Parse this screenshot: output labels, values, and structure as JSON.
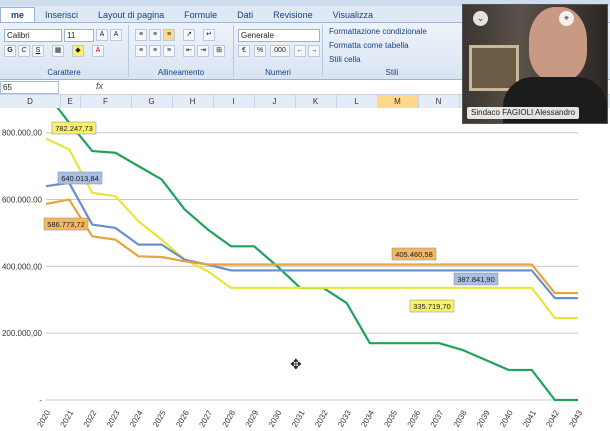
{
  "ribbon": {
    "tabs": [
      "me",
      "Inserisci",
      "Layout di pagina",
      "Formule",
      "Dati",
      "Revisione",
      "Visualizza"
    ],
    "active_tab": "me",
    "font_name": "Calibri",
    "font_size": "11",
    "number_format": "Generale",
    "percent_symbol": "%",
    "thousands": "000",
    "cond_format": "Formattazione condizionale",
    "format_table": "Formatta come tabella",
    "cell_styles": "Stili cella",
    "groups": {
      "font": "Carattere",
      "align": "Allineamento",
      "number": "Numeri",
      "styles": "Stili"
    }
  },
  "formula_bar": {
    "name_box": "65",
    "fx": "fx",
    "content": ""
  },
  "columns": [
    "D",
    "E",
    "F",
    "G",
    "H",
    "I",
    "J",
    "K",
    "L",
    "M",
    "N"
  ],
  "selected_column": "M",
  "video": {
    "participant": "Sindaco FAGIOLI Alessandro"
  },
  "chart_data": {
    "type": "line",
    "x": [
      "2020",
      "2021",
      "2022",
      "2023",
      "2024",
      "2025",
      "2026",
      "2027",
      "2028",
      "2029",
      "2030",
      "2031",
      "2032",
      "2033",
      "2034",
      "2035",
      "2036",
      "2037",
      "2038",
      "2039",
      "2040",
      "2041",
      "2042",
      "2043"
    ],
    "y_tick_labels": [
      "800.000,00",
      "600.000,00",
      "400.000,00",
      "200.000,00",
      "-"
    ],
    "ylim": [
      0,
      850000
    ],
    "grid": true,
    "series": [
      {
        "color": "#1fa35a",
        "values": [
          920000,
          830000,
          745000,
          740000,
          700000,
          660000,
          570000,
          510000,
          460000,
          460000,
          400000,
          335000,
          335000,
          290000,
          170000,
          170000,
          170000,
          170000,
          150000,
          120000,
          90000,
          90000,
          0,
          0
        ]
      },
      {
        "color": "#e8e43b",
        "values": [
          782247.73,
          750000,
          620000,
          610000,
          535000,
          480000,
          420000,
          385000,
          335719.7,
          335719.7,
          335719.7,
          335719.7,
          335719.7,
          335719.7,
          335719.7,
          335719.7,
          335719.7,
          335719.7,
          335719.7,
          335719.7,
          335719.7,
          335719.7,
          245000,
          245000
        ]
      },
      {
        "color": "#6a8fc8",
        "values": [
          640013.84,
          650000,
          525000,
          515000,
          465000,
          465000,
          420000,
          405000,
          387841.9,
          387841.9,
          387841.9,
          387841.9,
          387841.9,
          387841.9,
          387841.9,
          387841.9,
          387841.9,
          387841.9,
          387841.9,
          387841.9,
          387841.9,
          387841.9,
          305000,
          305000
        ]
      },
      {
        "color": "#e6a43a",
        "values": [
          586773.72,
          600000,
          490000,
          480000,
          430000,
          428000,
          415000,
          405460.58,
          405460.58,
          405460.58,
          405460.58,
          405460.58,
          405460.58,
          405460.58,
          405460.58,
          405460.58,
          405460.58,
          405460.58,
          405460.58,
          405460.58,
          405460.58,
          405460.58,
          320000,
          320000
        ]
      }
    ],
    "annotations": [
      {
        "text": "782.247,73",
        "color": "#f7f26a"
      },
      {
        "text": "640.013,84",
        "color": "#a8bfe4"
      },
      {
        "text": "586.773,72",
        "color": "#f4b860"
      },
      {
        "text": "405.460,58",
        "color": "#f4b860"
      },
      {
        "text": "387.841,90",
        "color": "#a8bfe4"
      },
      {
        "text": "335.719,70",
        "color": "#f7f26a"
      }
    ]
  }
}
